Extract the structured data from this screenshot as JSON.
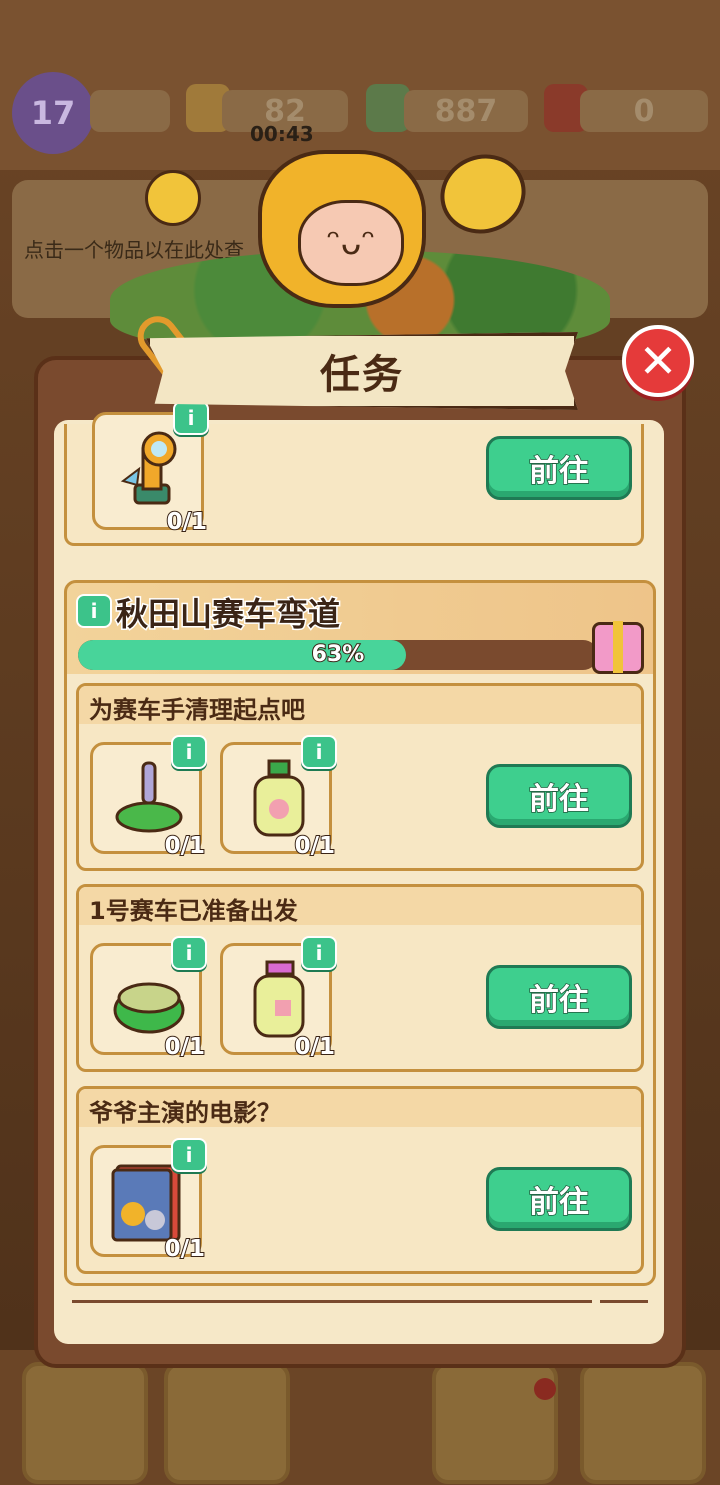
{
  "hud": {
    "level": "17",
    "energy": "82",
    "energy_timer": "00:43",
    "cash": "887",
    "gems": "0"
  },
  "hint_text": "点击一个物品以在此处查",
  "panel": {
    "title": "任务",
    "section_title": "秋田山赛车弯道",
    "progress_text": "63%",
    "progress_value": 0.63,
    "go_label": "前往",
    "tasks": [
      {
        "title": "",
        "items": [
          {
            "icon": "sprinkler-icon",
            "count": "0/1"
          }
        ]
      },
      {
        "title": "为赛车手清理起点吧",
        "items": [
          {
            "icon": "scrub-brush-icon",
            "count": "0/1"
          },
          {
            "icon": "soap-bottle-icon",
            "count": "0/1"
          }
        ]
      },
      {
        "title": "1号赛车已准备出发",
        "items": [
          {
            "icon": "sponge-icon",
            "count": "0/1"
          },
          {
            "icon": "shampoo-bottle-icon",
            "count": "0/1"
          }
        ]
      },
      {
        "title": "爷爷主演的电影？",
        "items": [
          {
            "icon": "movie-poster-icon",
            "count": "0/1"
          }
        ]
      }
    ]
  },
  "colors": {
    "accent_green": "#3ecf8e",
    "close_red": "#e53a3a",
    "panel_brown": "#7a4a2e",
    "card_bg": "#f7e7c4"
  }
}
